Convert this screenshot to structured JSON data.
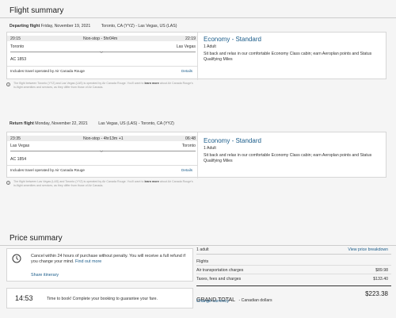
{
  "flight_summary": {
    "title": "Flight summary",
    "departing": {
      "label": "Departing flight",
      "date": "Friday, November 19, 2021",
      "route": "Toronto, CA (YYZ) - Las Vegas, US (LAS)",
      "depart_time": "20:15",
      "arrive_time": "22:19",
      "stops": "Non-stop - 5hr04m",
      "origin": "Toronto",
      "destination": "Las Vegas",
      "flight_no": "AC 1853",
      "operated": "Includes travel operated by Air Canada Rouge",
      "details": "Details",
      "fare_title": "Economy - Standard",
      "adults": "1 Adult",
      "fare_desc": "Sit back and relax in our comfortable Economy Class cabin; earn Aeroplan points and Status Qualifying Miles",
      "note": "The flight between Toronto (YYZ) and Las Vegas (LAS) is operated by Air Canada Rouge. You'll want to",
      "note_link": "learn more",
      "note_rest": "about Air Canada Rouge's in-flight amenities and services, as they differ from those of Air Canada."
    },
    "return": {
      "label": "Return flight",
      "date": "Monday, November 22, 2021",
      "route": "Las Vegas, US (LAS) - Toronto, CA (YYZ)",
      "depart_time": "23:35",
      "arrive_time": "06:48",
      "stops": "Non-stop - 4hr13m +1",
      "origin": "Las Vegas",
      "destination": "Toronto",
      "flight_no": "AC 1854",
      "operated": "Includes travel operated by Air Canada Rouge",
      "details": "Details",
      "fare_title": "Economy - Standard",
      "adults": "1 Adult",
      "fare_desc": "Sit back and relax in our comfortable Economy Class cabin; earn Aeroplan points and Status Qualifying Miles",
      "note": "The flight between Las Vegas (LAS) and Toronto (YYZ) is operated by Air Canada Rouge. You'll want to",
      "note_link": "learn more",
      "note_rest": "about Air Canada Rouge's in-flight amenities and services, as they differ from those of Air Canada."
    }
  },
  "price_summary": {
    "title": "Price summary",
    "cancel_bold": "Cancel within 24 hours",
    "cancel_text": "of purchase without penalty. You will receive a full refund if you change your mind.",
    "find_out_more": "Find out more",
    "share_itinerary": "Share itinerary",
    "timer": "14:53",
    "timer_text": "Time to book! Complete your booking to guarantee your fare.",
    "adult_count": "1 adult",
    "view_breakdown": "View price breakdown",
    "flights_label": "Flights",
    "air_transport_label": "Air transportation charges",
    "air_transport_value": "$89.98",
    "taxes_label": "Taxes, fees and charges",
    "taxes_value": "$133.40",
    "grand_total_label": "GRAND TOTAL",
    "grand_total_currency": "- Canadian dollars",
    "grand_total_value": "$223.38",
    "change_currency": "Change currency"
  }
}
